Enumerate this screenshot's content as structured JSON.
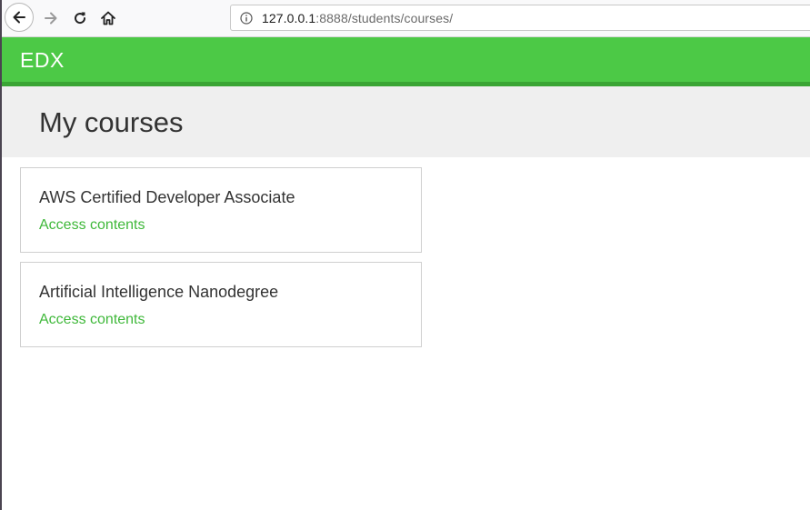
{
  "browser": {
    "url_host": "127.0.0.1",
    "url_rest": ":8888/students/courses/"
  },
  "site": {
    "brand": "EDX"
  },
  "page": {
    "title": "My courses"
  },
  "courses": [
    {
      "title": "AWS Certified Developer Associate",
      "link_label": "Access contents"
    },
    {
      "title": "Artificial Intelligence Nanodegree",
      "link_label": "Access contents"
    }
  ],
  "colors": {
    "header_green": "#4cc946",
    "header_border": "#3aa534",
    "link_green": "#3fb83a",
    "heading_band": "#efefef"
  },
  "icons": {
    "back": "back-arrow-icon",
    "forward": "forward-arrow-icon",
    "reload": "reload-icon",
    "home": "home-icon",
    "info": "info-icon"
  }
}
